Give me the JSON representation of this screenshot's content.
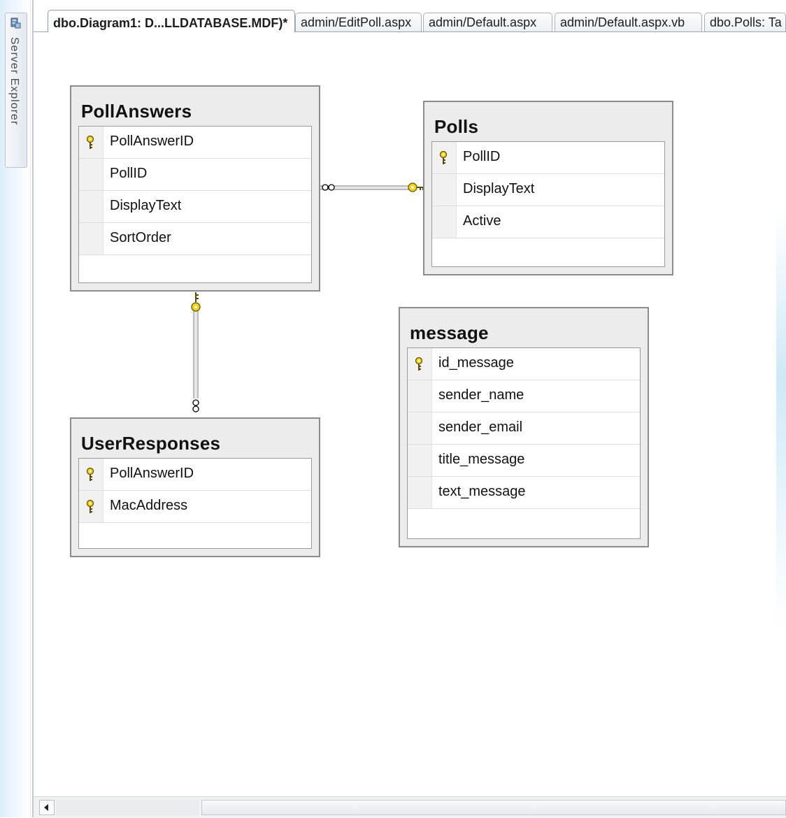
{
  "sidebar": {
    "server_explorer_label": "Server Explorer"
  },
  "tabs": [
    {
      "label": "dbo.Diagram1: D...LLDATABASE.MDF)*",
      "active": true
    },
    {
      "label": "admin/EditPoll.aspx",
      "active": false
    },
    {
      "label": "admin/Default.aspx",
      "active": false
    },
    {
      "label": "admin/Default.aspx.vb",
      "active": false
    },
    {
      "label": "dbo.Polls: Ta",
      "active": false
    }
  ],
  "tables": {
    "pollanswers": {
      "title": "PollAnswers",
      "columns": [
        {
          "name": "PollAnswerID",
          "primary_key": true
        },
        {
          "name": "PollID",
          "primary_key": false
        },
        {
          "name": "DisplayText",
          "primary_key": false
        },
        {
          "name": "SortOrder",
          "primary_key": false
        }
      ]
    },
    "polls": {
      "title": "Polls",
      "columns": [
        {
          "name": "PollID",
          "primary_key": true
        },
        {
          "name": "DisplayText",
          "primary_key": false
        },
        {
          "name": "Active",
          "primary_key": false
        }
      ]
    },
    "userresponses": {
      "title": "UserResponses",
      "columns": [
        {
          "name": "PollAnswerID",
          "primary_key": true
        },
        {
          "name": "MacAddress",
          "primary_key": true
        }
      ]
    },
    "message": {
      "title": "message",
      "columns": [
        {
          "name": "id_message",
          "primary_key": true
        },
        {
          "name": "sender_name",
          "primary_key": false
        },
        {
          "name": "sender_email",
          "primary_key": false
        },
        {
          "name": "title_message",
          "primary_key": false
        },
        {
          "name": "text_message",
          "primary_key": false
        }
      ]
    }
  },
  "relationships": [
    {
      "from": "PollAnswers",
      "to": "Polls",
      "many_end": "PollAnswers",
      "key_end": "Polls"
    },
    {
      "from": "UserResponses",
      "to": "PollAnswers",
      "many_end": "UserResponses",
      "key_end": "PollAnswers"
    }
  ],
  "colors": {
    "key_icon": "#f2d20a",
    "table_border": "#8c8c8c",
    "table_bg": "#ececec"
  }
}
